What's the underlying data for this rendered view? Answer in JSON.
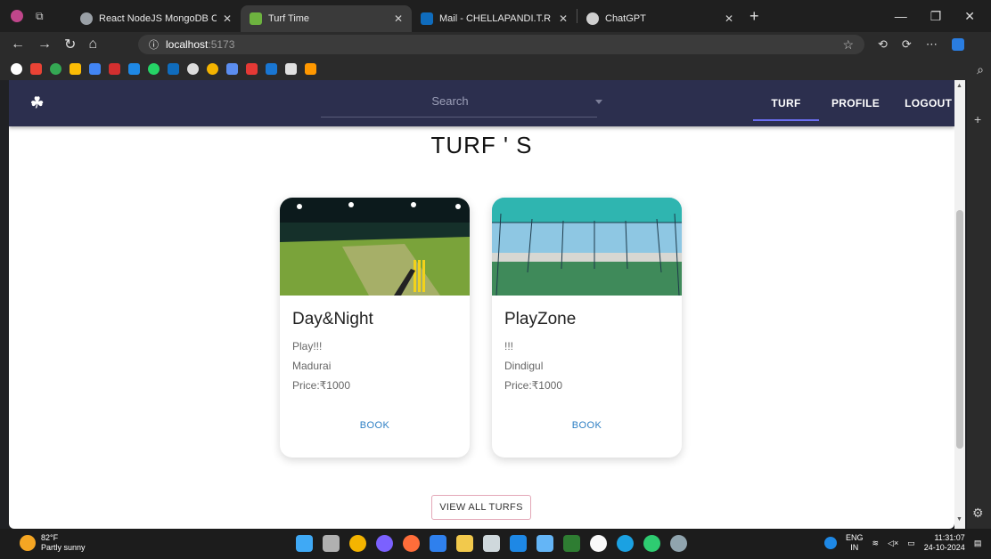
{
  "browser": {
    "tabs": [
      {
        "title": "React NodeJS MongoDB Concept",
        "favicon_color": "#9aa0a6",
        "active": false
      },
      {
        "title": "Turf Time",
        "favicon_color": "#6db33f",
        "active": true
      },
      {
        "title": "Mail - CHELLAPANDI.T.R - Outloo",
        "favicon_color": "#0f6cbd",
        "active": false
      },
      {
        "title": "ChatGPT",
        "favicon_color": "#cfcfcf",
        "active": false
      }
    ],
    "url_host": "localhost",
    "url_port": ":5173"
  },
  "app": {
    "logo": "☘",
    "search_placeholder": "Search",
    "nav": [
      {
        "label": "TURF",
        "active": true
      },
      {
        "label": "PROFILE",
        "active": false
      },
      {
        "label": "LOGOUT",
        "active": false
      }
    ],
    "page_title": "TURF ' S",
    "turfs": [
      {
        "name": "Day&Night",
        "description": "Play!!!",
        "location": "Madurai",
        "price": "Price:₹1000",
        "book_label": "BOOK"
      },
      {
        "name": "PlayZone",
        "description": "!!!",
        "location": "Dindigul",
        "price": "Price:₹1000",
        "book_label": "BOOK"
      }
    ],
    "view_all_label": "VIEW ALL TURFS"
  },
  "taskbar": {
    "temperature": "82°F",
    "weather": "Partly sunny",
    "lang_top": "ENG",
    "lang_bottom": "IN",
    "time": "11:31:07",
    "date": "24-10-2024"
  },
  "colors": {
    "appbar": "#2c2f4e",
    "book_link": "#2d7fc4",
    "nav_indicator": "#6a6df0"
  }
}
